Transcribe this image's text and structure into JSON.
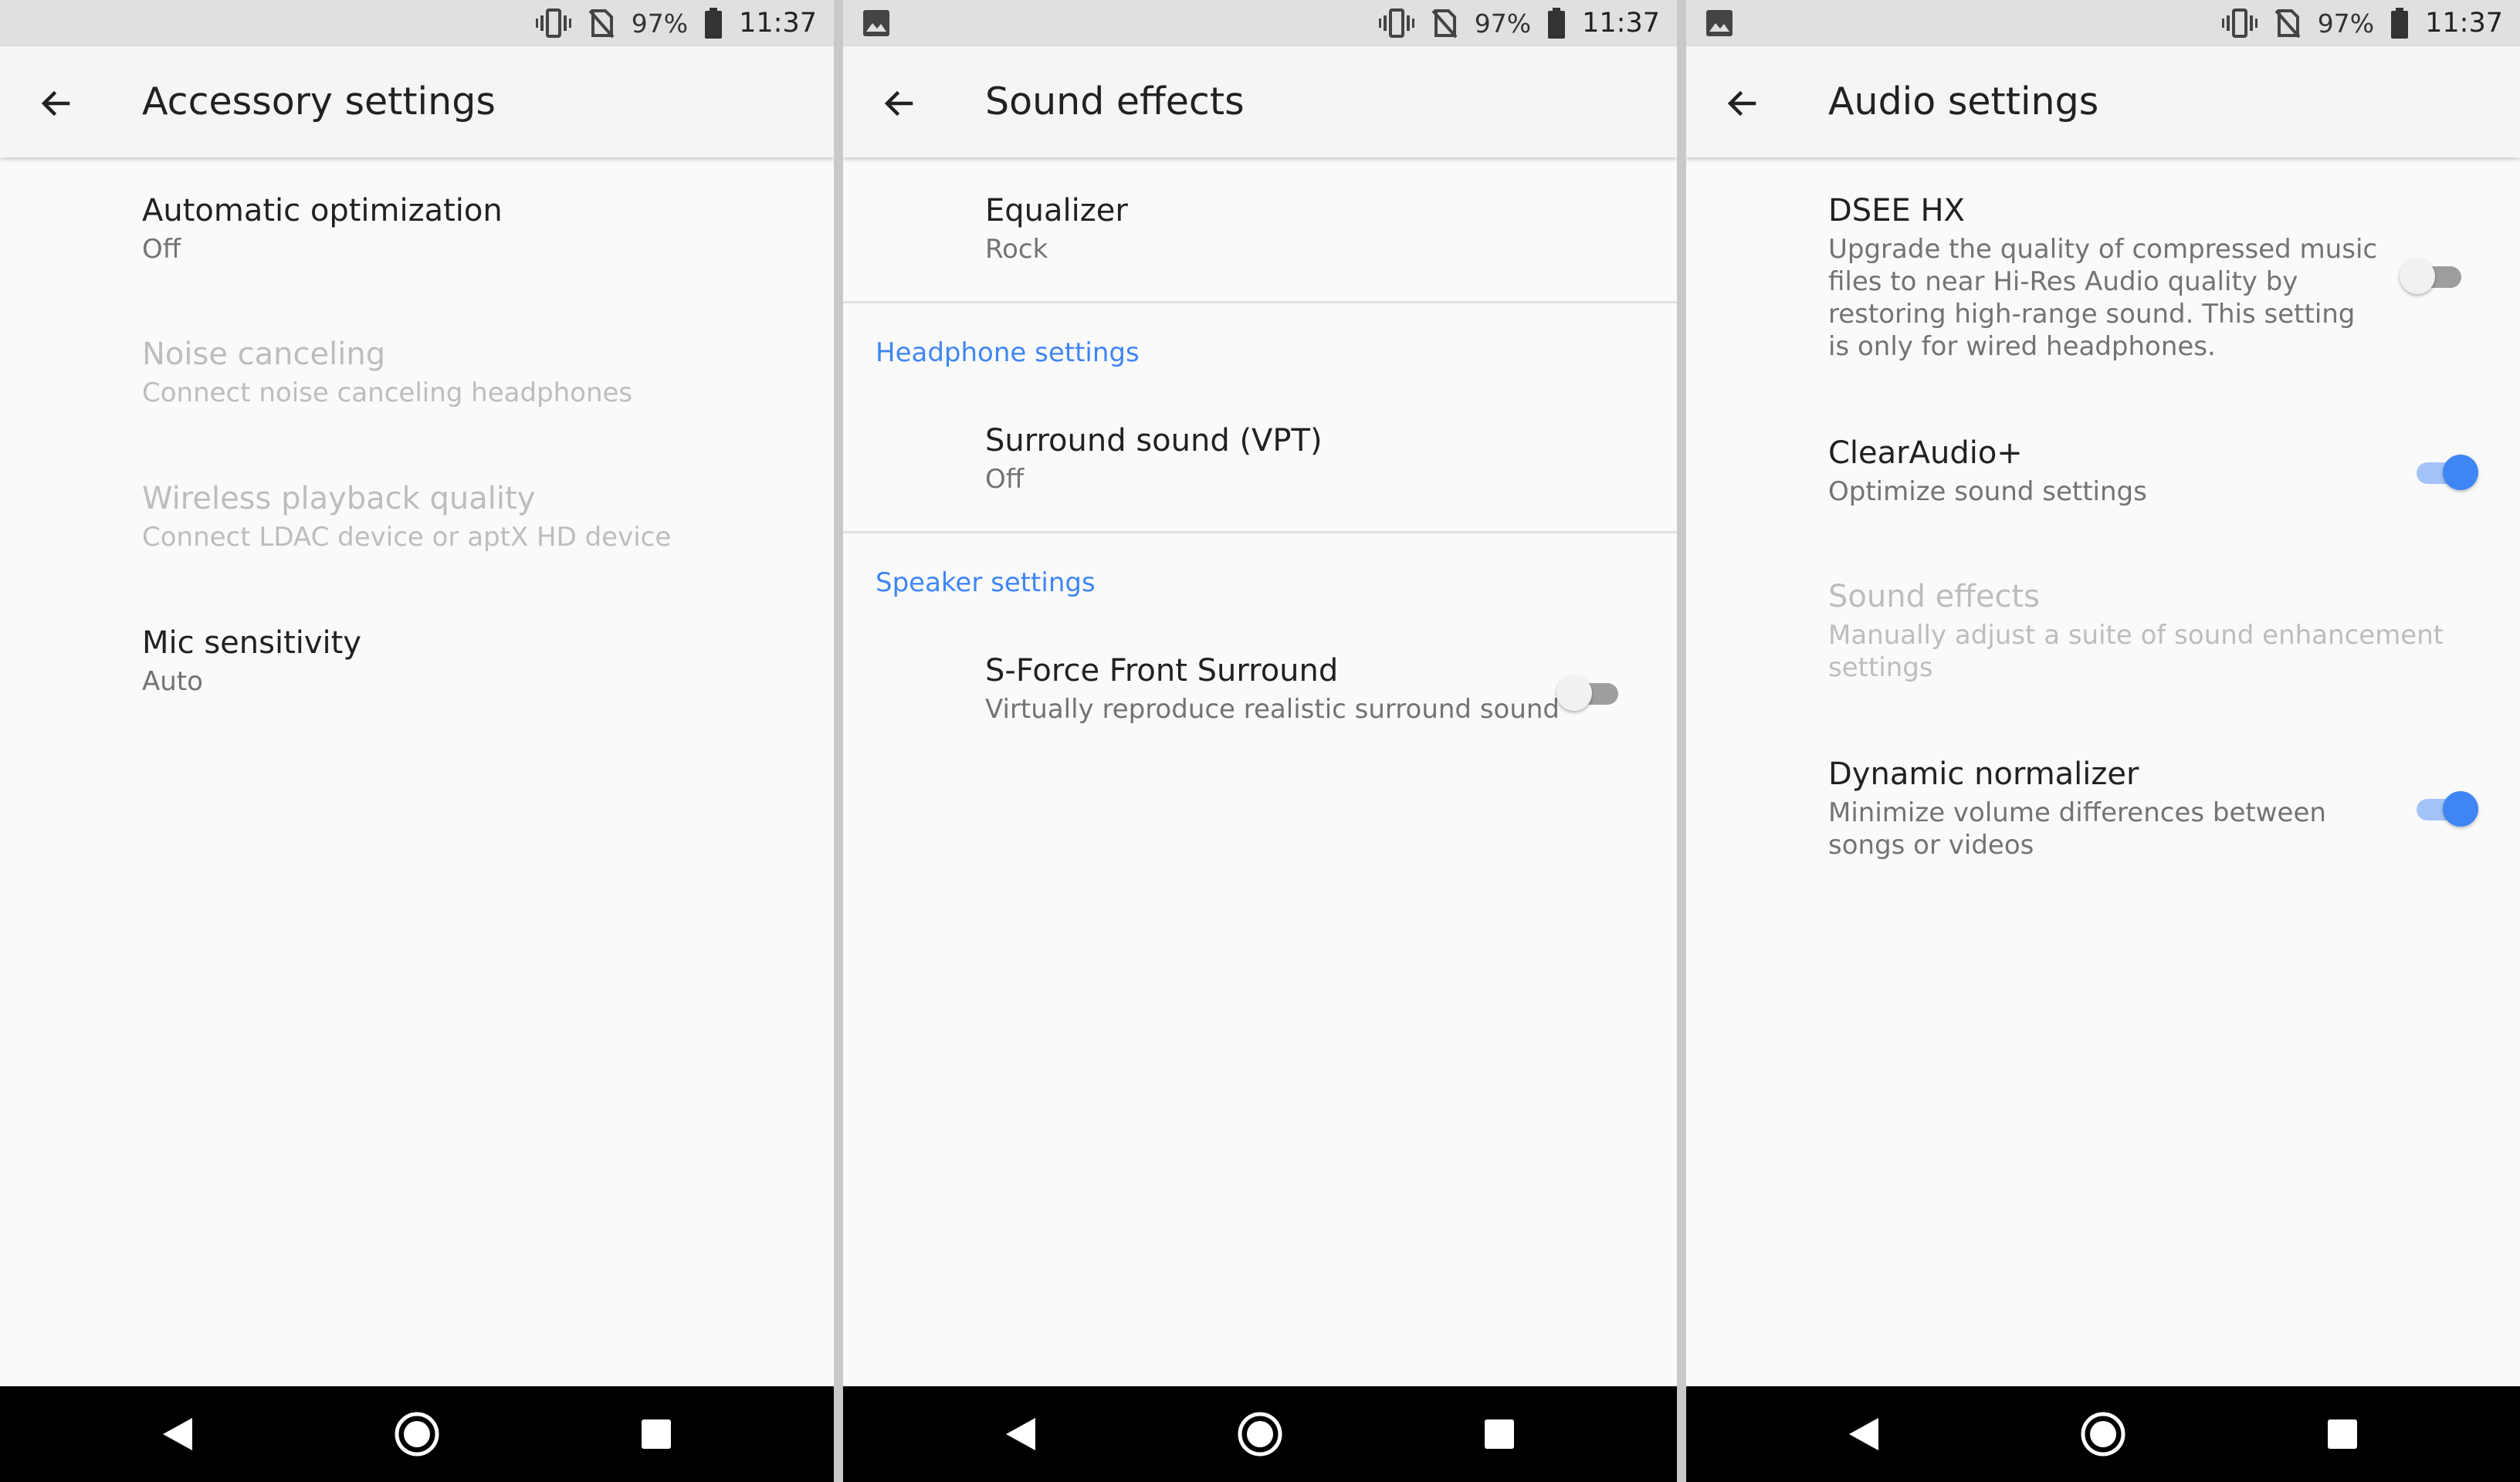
{
  "status": {
    "battery_pct": "97%",
    "time": "11:37"
  },
  "screens": [
    {
      "title": "Accessory settings",
      "items": [
        {
          "title": "Automatic optimization",
          "summary": "Off"
        },
        {
          "title": "Noise canceling",
          "summary": "Connect noise canceling headphones",
          "disabled": true
        },
        {
          "title": "Wireless playback quality",
          "summary": "Connect LDAC device or aptX HD device",
          "disabled": true
        },
        {
          "title": "Mic sensitivity",
          "summary": "Auto"
        }
      ]
    },
    {
      "title": "Sound effects",
      "items": [
        {
          "title": "Equalizer",
          "summary": "Rock"
        }
      ],
      "sections": [
        {
          "header": "Headphone settings",
          "items": [
            {
              "title": "Surround sound (VPT)",
              "summary": "Off"
            }
          ]
        },
        {
          "header": "Speaker settings",
          "items": [
            {
              "title": "S-Force Front Surround",
              "summary": "Virtually reproduce realistic surround sound",
              "switch": "off"
            }
          ]
        }
      ]
    },
    {
      "title": "Audio settings",
      "items": [
        {
          "title": "DSEE HX",
          "summary": "Upgrade the quality of compressed music files to near Hi-Res Audio quality by restoring high-range sound. This setting is only for wired headphones.",
          "switch": "off"
        },
        {
          "title": "ClearAudio+",
          "summary": "Optimize sound settings",
          "switch": "on"
        },
        {
          "title": "Sound effects",
          "summary": "Manually adjust a suite of sound enhancement settings",
          "disabled": true
        },
        {
          "title": "Dynamic normalizer",
          "summary": "Minimize volume differences between songs or videos",
          "switch": "on"
        }
      ]
    }
  ],
  "colors": {
    "accent": "#3f86f4",
    "switch_on_track": "#a4c3f7",
    "disabled_text": "#bdbdbd",
    "nav_bar": "#000000",
    "status_bar": "#e0e0e0"
  },
  "icons": [
    "image-notification-icon",
    "vibrate-icon",
    "no-sim-icon",
    "battery-icon",
    "back-arrow-icon",
    "nav-back-icon",
    "nav-home-icon",
    "nav-recents-icon"
  ]
}
